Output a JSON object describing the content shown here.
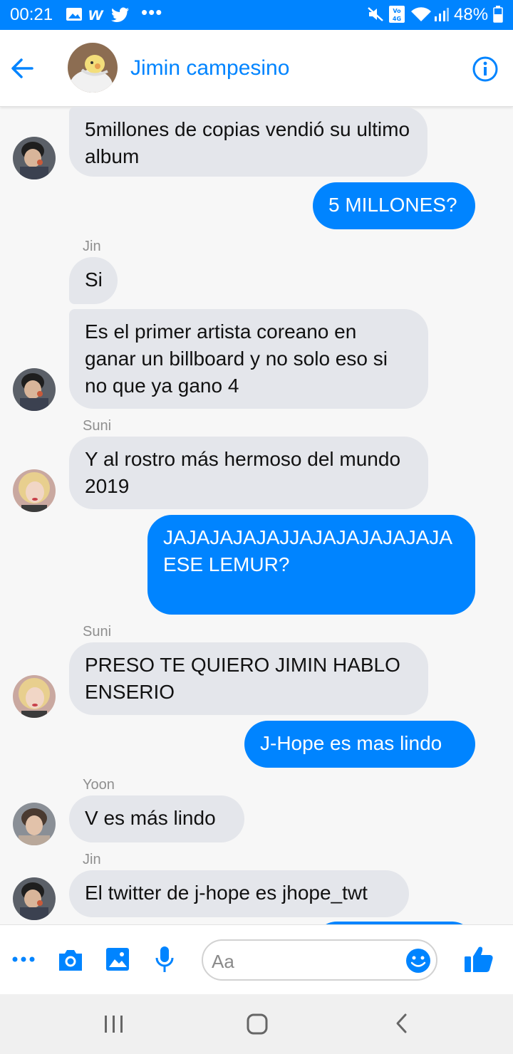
{
  "status_bar": {
    "time": "00:21",
    "battery": "48%"
  },
  "header": {
    "contact_name": "Jimin campesino"
  },
  "messages": [
    {
      "dir": "in",
      "text": "5millones de copias vendió su ultimo album"
    },
    {
      "dir": "out",
      "text": "5 MILLONES?"
    },
    {
      "dir": "in",
      "sender": "Jin",
      "text": "Si"
    },
    {
      "dir": "in",
      "text": "Es el primer artista coreano en ganar un billboard y no solo eso si no que ya gano 4"
    },
    {
      "dir": "in",
      "sender": "Suni",
      "text": "Y al rostro más hermoso del mundo 2019"
    },
    {
      "dir": "out",
      "text": "JAJAJAJAJAJJAJAJAJAJAJAJA ESE LEMUR?"
    },
    {
      "dir": "in",
      "sender": "Suni",
      "text": "PRESO TE QUIERO JIMIN HABLO ENSERIO"
    },
    {
      "dir": "out",
      "text": "J-Hope es mas lindo"
    },
    {
      "dir": "in",
      "sender": "Yoon",
      "text": "V es más lindo"
    },
    {
      "dir": "in",
      "sender": "Jin",
      "text": "El twitter de j-hope es jhope_twt"
    }
  ],
  "composer": {
    "placeholder": "Aa"
  },
  "colors": {
    "accent": "#0084ff",
    "incoming_bubble": "#e4e6eb"
  }
}
